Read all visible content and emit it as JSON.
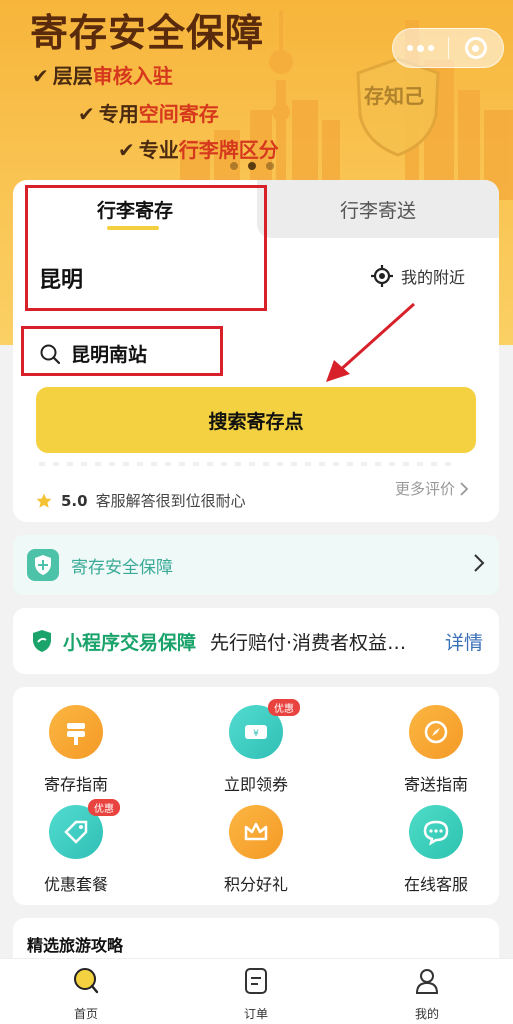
{
  "window": {
    "more_button": "more-options",
    "close_button": "close-miniprogram"
  },
  "banner": {
    "title": "寄存安全保障",
    "features": [
      {
        "prefix": "层层",
        "highlight": "审核入驻",
        "suffix": ""
      },
      {
        "prefix": "专用",
        "highlight": "空间寄存",
        "suffix": ""
      },
      {
        "prefix": "专业",
        "highlight": "行李牌区分",
        "suffix": ""
      }
    ],
    "shield_text": "存知己",
    "carousel_index": 1,
    "carousel_total": 3
  },
  "search": {
    "tabs": [
      "行李寄存",
      "行李寄送"
    ],
    "active_tab": 0,
    "city": "昆明",
    "nearby_label": "我的附近",
    "station_value": "昆明南站",
    "search_button": "搜索寄存点",
    "review_score": "5.0",
    "review_text": "客服解答很到位很耐心",
    "more_reviews": "更多评价"
  },
  "safety": {
    "label": "寄存安全保障"
  },
  "guarantee": {
    "title": "小程序交易保障",
    "description": "先行赔付·消费者权益保障",
    "detail": "详情"
  },
  "services": [
    {
      "label": "寄存指南",
      "icon": "signpost-icon",
      "badge": ""
    },
    {
      "label": "立即领券",
      "icon": "coupon-icon",
      "badge": "优惠"
    },
    {
      "label": "寄送指南",
      "icon": "compass-icon",
      "badge": ""
    },
    {
      "label": "优惠套餐",
      "icon": "tag-icon",
      "badge": "优惠"
    },
    {
      "label": "积分好礼",
      "icon": "crown-icon",
      "badge": ""
    },
    {
      "label": "在线客服",
      "icon": "chat-icon",
      "badge": ""
    }
  ],
  "guides": {
    "title": "精选旅游攻略"
  },
  "bottom_nav": [
    {
      "label": "首页",
      "icon": "home-search-icon",
      "active": true
    },
    {
      "label": "订单",
      "icon": "order-icon",
      "active": false
    },
    {
      "label": "我的",
      "icon": "profile-icon",
      "active": false
    }
  ],
  "colors": {
    "banner": "#f9c24f",
    "accent_yellow": "#f3d140",
    "annotation_red": "#d8202a",
    "guarantee_green": "#1aa36b",
    "detail_blue": "#3a6fb8",
    "safety_teal": "#3aaa97",
    "badge_red": "#e9433f"
  }
}
